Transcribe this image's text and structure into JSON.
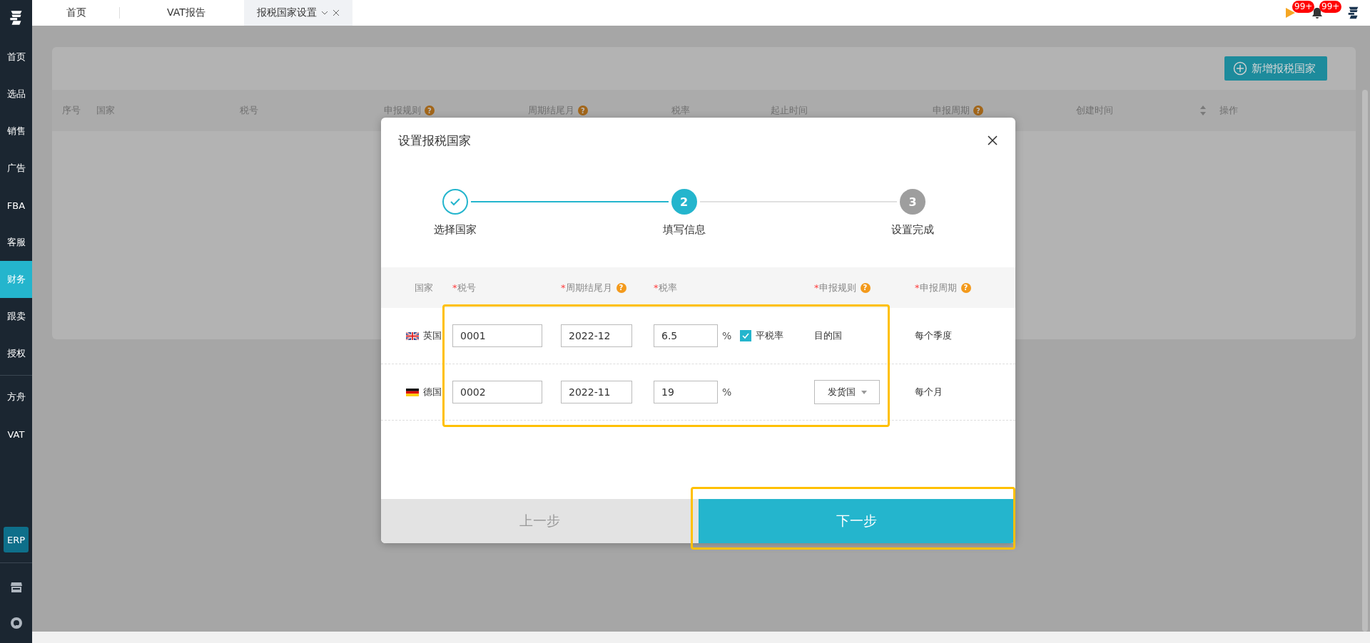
{
  "sidebar": {
    "items": [
      {
        "label": "首页",
        "selected": false
      },
      {
        "label": "选品",
        "selected": false
      },
      {
        "label": "销售",
        "selected": false
      },
      {
        "label": "广告",
        "selected": false
      },
      {
        "label": "FBA",
        "selected": false
      },
      {
        "label": "客服",
        "selected": false
      },
      {
        "label": "财务",
        "selected": true
      },
      {
        "label": "跟卖",
        "selected": false
      },
      {
        "label": "授权",
        "selected": false
      }
    ],
    "more_items": [
      {
        "label": "方舟",
        "selected": false
      },
      {
        "label": "VAT",
        "selected": false
      }
    ],
    "erp_badge": "ERP"
  },
  "tabs": [
    {
      "label": "首页",
      "selected": false,
      "closable": false
    },
    {
      "label": "VAT报告",
      "selected": false,
      "closable": false
    },
    {
      "label": "报税国家设置",
      "selected": true,
      "closable": true
    }
  ],
  "notifications": {
    "flag_badge": "99+",
    "bell_badge": "99+"
  },
  "page": {
    "add_button": "新增报税国家",
    "columns": [
      {
        "label": "序号",
        "kind": "plain"
      },
      {
        "label": "国家",
        "kind": "plain"
      },
      {
        "label": "税号",
        "kind": "plain"
      },
      {
        "label": "申报规则",
        "help": "?",
        "kind": "plain"
      },
      {
        "label": "周期结尾月",
        "help": "?",
        "kind": "plain"
      },
      {
        "label": "税率",
        "kind": "plain"
      },
      {
        "label": "起止时间",
        "kind": "plain"
      },
      {
        "label": "申报周期",
        "help": "?",
        "kind": "plain"
      },
      {
        "label": "创建时间",
        "kind": "sortable"
      },
      {
        "label": "操作",
        "kind": "plain"
      }
    ]
  },
  "dialog": {
    "title": "设置报税国家",
    "steps": [
      {
        "label": "选择国家",
        "kind": "done"
      },
      {
        "number": "2",
        "label": "填写信息",
        "kind": "active"
      },
      {
        "number": "3",
        "label": "设置完成",
        "kind": "pending"
      }
    ],
    "columns": [
      {
        "label": "国家"
      },
      {
        "required_mark": "*",
        "label": "税号"
      },
      {
        "required_mark": "*",
        "label": "周期结尾月",
        "help": "?"
      },
      {
        "required_mark": "*",
        "label": "税率"
      },
      {
        "required_mark": "*",
        "label": "申报规则",
        "help": "?"
      },
      {
        "required_mark": "*",
        "label": "申报周期",
        "help": "?"
      }
    ],
    "rows": [
      {
        "flag": {
          "kind": "gb"
        },
        "country": "英国",
        "tax_no": "0001",
        "period_end": "2022-12",
        "rate": "6.5",
        "unit": "%",
        "flat_rate": {
          "label": "平税率",
          "checked": true
        },
        "rule": {
          "kind": "text",
          "value": "目的国"
        },
        "cycle": "每个季度"
      },
      {
        "flag": {
          "kind": "de"
        },
        "country": "德国",
        "tax_no": "0002",
        "period_end": "2022-11",
        "rate": "19",
        "unit": "%",
        "rule": {
          "kind": "select",
          "value": "发货国"
        },
        "cycle": "每个月"
      }
    ],
    "prev_button": "上一步",
    "next_button": "下一步"
  }
}
